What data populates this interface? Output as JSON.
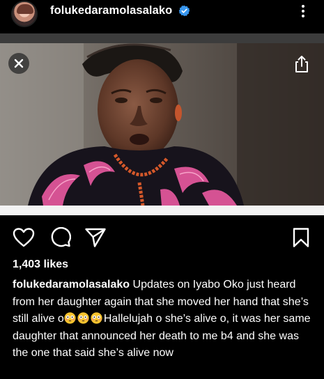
{
  "header": {
    "username": "folukedaramolasalako",
    "verified_icon": "verified-badge-icon",
    "more_icon": "more-options-icon"
  },
  "media": {
    "close_icon": "close-icon",
    "share_icon": "share-icon"
  },
  "actions": {
    "like_icon": "heart-icon",
    "comment_icon": "comment-icon",
    "share_icon": "send-icon",
    "save_icon": "bookmark-icon"
  },
  "likes": "1,403 likes",
  "caption": {
    "username": "folukedaramolasalako",
    "text_part1": " Updates on Iyabo Oko just heard  from her daughter again that she moved her hand that she’s still alive o",
    "emojis": [
      "flushed-face-icon",
      "flushed-face-icon",
      "flushed-face-icon"
    ],
    "text_part2": "Hallelujah o she’s alive o, it was her same daughter that announced her death to me b4 and she was the one that said she’s alive now"
  },
  "colors": {
    "background": "#000000",
    "verified_blue": "#3897f0",
    "divider_gray": "#3c3c3c",
    "emoji_yellow": "#f7c32e"
  }
}
